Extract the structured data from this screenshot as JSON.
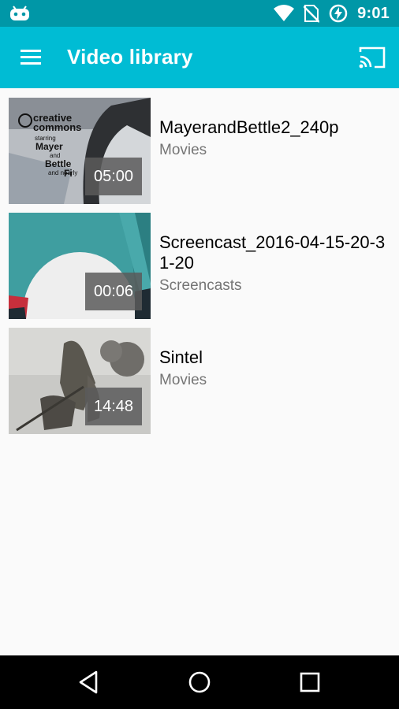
{
  "status_bar": {
    "time": "9:01",
    "icons": [
      "android-debug-icon",
      "wifi-icon",
      "no-sim-icon",
      "battery-charging-icon"
    ]
  },
  "app_bar": {
    "title": "Video library",
    "menu_icon": "hamburger-menu-icon",
    "cast_icon": "cast-icon",
    "color": "#00bcd4"
  },
  "videos": [
    {
      "title": "MayerandBettle2_240p",
      "category": "Movies",
      "duration": "05:00"
    },
    {
      "title": "Screencast_2016-04-15-20-31-20",
      "category": "Screencasts",
      "duration": "00:06"
    },
    {
      "title": "Sintel",
      "category": "Movies",
      "duration": "14:48"
    }
  ],
  "thumbnail_1_text": [
    "creative",
    "commons",
    "starring",
    "Mayer",
    "and",
    "Bettle",
    "and nearly",
    "Fi"
  ],
  "nav_bar": {
    "icons": [
      "back-icon",
      "home-icon",
      "recents-icon"
    ]
  }
}
